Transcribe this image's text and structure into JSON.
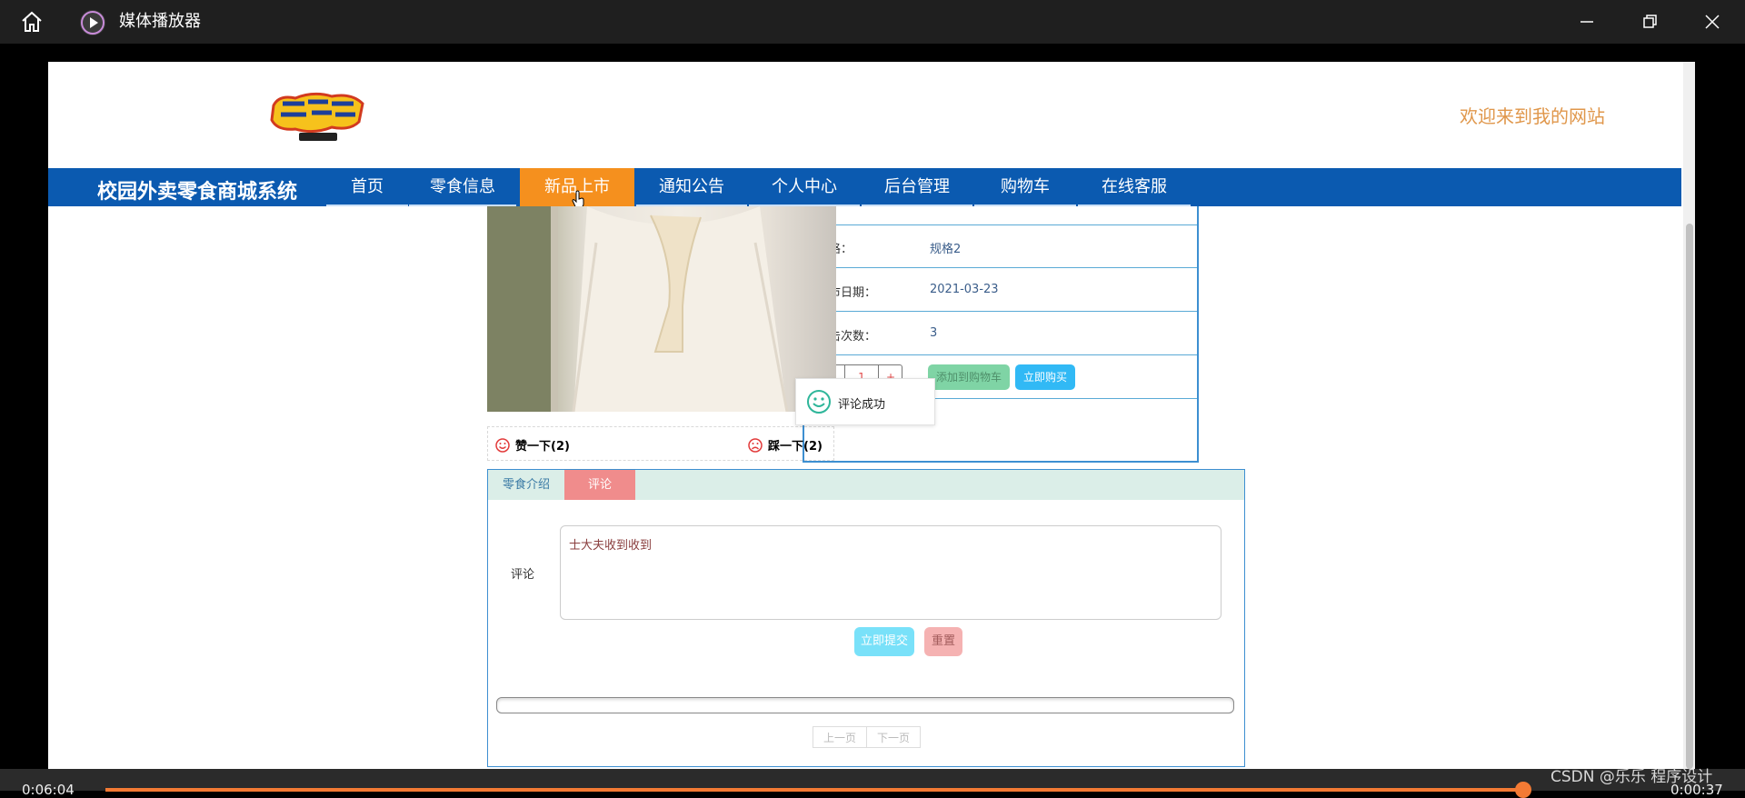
{
  "player": {
    "title": "媒体播放器",
    "time_elapsed": "0:06:04",
    "time_remaining": "0:00:37",
    "progress": 0.89
  },
  "site": {
    "welcome": "欢迎来到我的网站",
    "brand": "校园外卖零食商城系统",
    "nav": [
      "首页",
      "零食信息",
      "新品上市",
      "通知公告",
      "个人中心",
      "后台管理",
      "购物车",
      "在线客服"
    ],
    "active_nav": "新品上市"
  },
  "product": {
    "rows": [
      {
        "label": "规格：",
        "value": "规格2"
      },
      {
        "label": "上市日期：",
        "value": "2021-03-23"
      },
      {
        "label": "点击次数：",
        "value": "3"
      }
    ],
    "quantity": "1",
    "minus": "-",
    "plus": "+",
    "add_cart_label": "添加到购物车",
    "buy_label": "立即购买",
    "like_label": "赞一下(2)",
    "dislike_label": "踩一下(2)"
  },
  "toast": {
    "text": "评论成功"
  },
  "tabs": {
    "intro_label": "零食介绍",
    "comment_label": "评论",
    "comment_field_label": "评论",
    "comment_text": "士大夫收到收到",
    "submit_label": "立即提交",
    "reset_label": "重置",
    "prev_label": "上一页",
    "next_label": "下一页"
  },
  "watermark": "CSDN @乐乐 程序设计"
}
